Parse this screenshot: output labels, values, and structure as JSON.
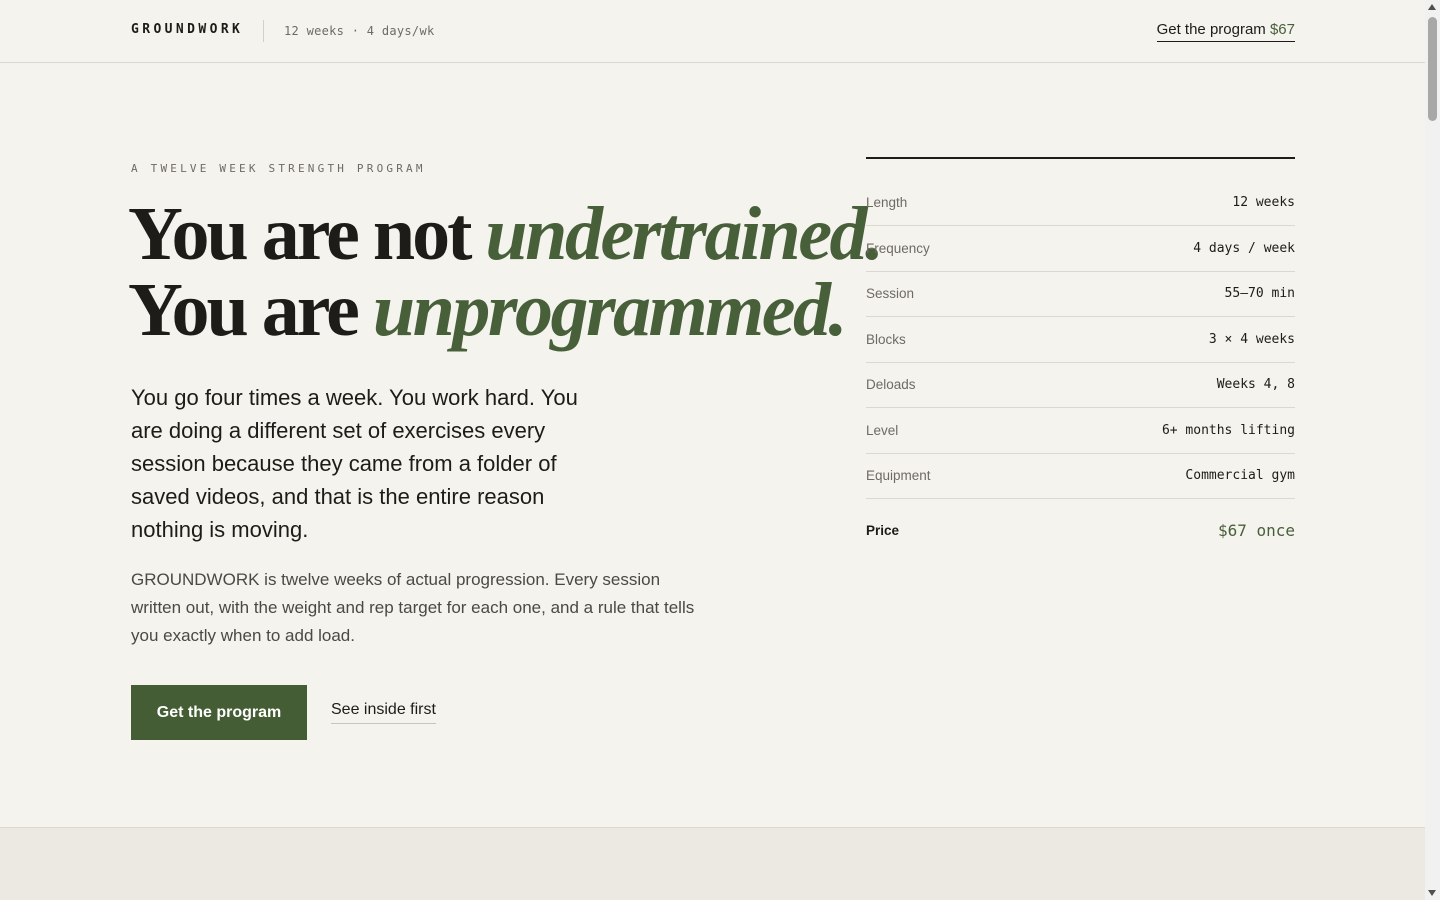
{
  "header": {
    "brand": "GROUNDWORK",
    "meta": "12 weeks · 4 days/wk",
    "cta_label": "Get the program",
    "cta_price": "$67"
  },
  "hero": {
    "eyebrow": "A TWELVE WEEK STRENGTH PROGRAM",
    "headline_line1_plain": "You are not ",
    "headline_line1_emph": "undertrained.",
    "headline_line2_plain": "You are ",
    "headline_line2_emph": "unprogrammed.",
    "lead": "You go four times a week. You work hard. You are doing a different set of exercises every session because they came from a folder of saved videos, and that is the entire reason nothing is moving.",
    "body": "GROUNDWORK is twelve weeks of actual progression. Every session written out, with the weight and rep target for each one, and a rule that tells you exactly when to add load.",
    "primary_button": "Get the program",
    "secondary_link": "See inside first"
  },
  "specs": {
    "rows": [
      {
        "label": "Length",
        "value": "12 weeks"
      },
      {
        "label": "Frequency",
        "value": "4 days / week"
      },
      {
        "label": "Session",
        "value": "55–70 min"
      },
      {
        "label": "Blocks",
        "value": "3 × 4 weeks"
      },
      {
        "label": "Deloads",
        "value": "Weeks 4, 8"
      },
      {
        "label": "Level",
        "value": "6+ months lifting"
      },
      {
        "label": "Equipment",
        "value": "Commercial gym"
      }
    ],
    "price_label": "Price",
    "price_value": "$67 once"
  },
  "colors": {
    "accent": "#48603a",
    "button": "#455d35",
    "background": "#f5f3ee",
    "text": "#1d1c18"
  }
}
